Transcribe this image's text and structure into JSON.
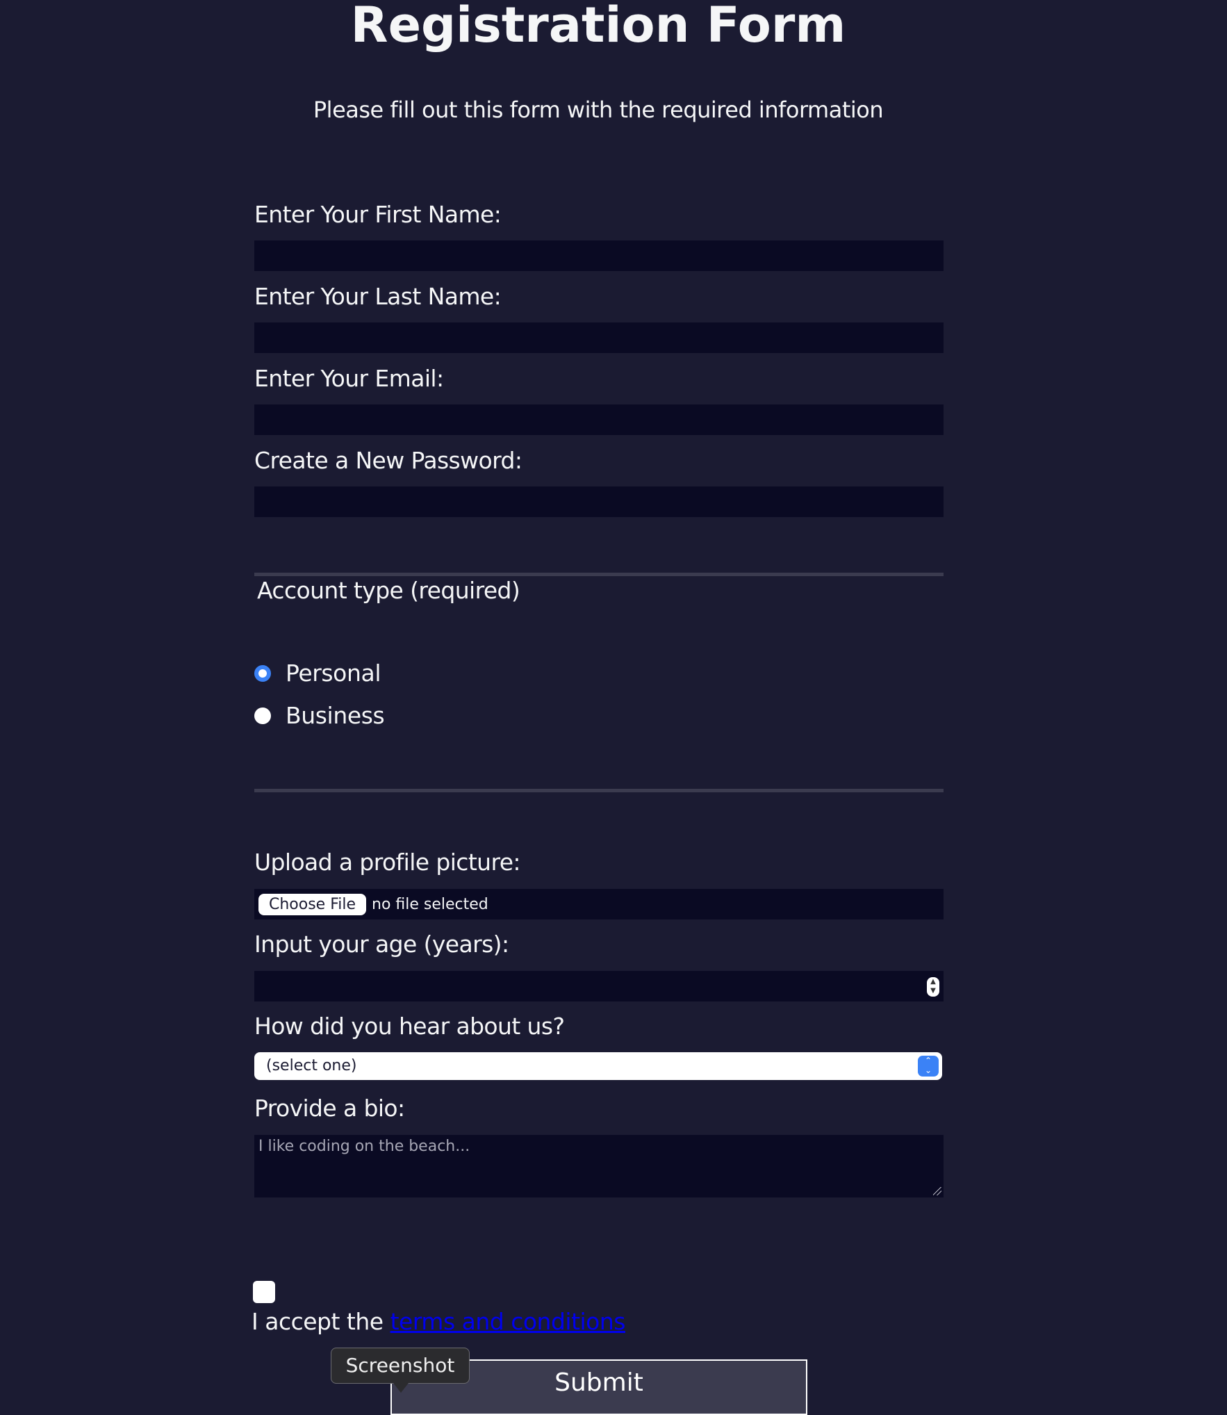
{
  "page": {
    "title": "Registration Form",
    "subtitle": "Please fill out this form with the required information"
  },
  "fields": {
    "first_name_label": "Enter Your First Name:",
    "first_name_value": "",
    "last_name_label": "Enter Your Last Name:",
    "last_name_value": "",
    "email_label": "Enter Your Email:",
    "email_value": "",
    "password_label": "Create a New Password:",
    "password_value": ""
  },
  "account_type": {
    "legend": "Account type (required)",
    "options": [
      {
        "label": "Personal",
        "checked": true
      },
      {
        "label": "Business",
        "checked": false
      }
    ]
  },
  "profile": {
    "picture_label": "Upload a profile picture:",
    "file_button": "Choose File",
    "file_status": "no file selected",
    "age_label": "Input your age (years):",
    "age_value": "",
    "referrer_label": "How did you hear about us?",
    "referrer_selected": "(select one)",
    "bio_label": "Provide a bio:",
    "bio_placeholder": "I like coding on the beach..."
  },
  "terms": {
    "checked": false,
    "text": "I accept the",
    "link_text": "terms and conditions"
  },
  "submit_label": "Submit",
  "tooltip": "Screenshot",
  "colors": {
    "background": "#1b1b32",
    "input_background": "#0a0a23",
    "divider": "#3b3b4f",
    "accent": "#3b82f6",
    "link": "#0000ee"
  },
  "icons": {
    "stepper": "up-down-stepper-icon",
    "select_arrows": "chevron-up-down-icon",
    "resize": "resize-grip-icon"
  }
}
